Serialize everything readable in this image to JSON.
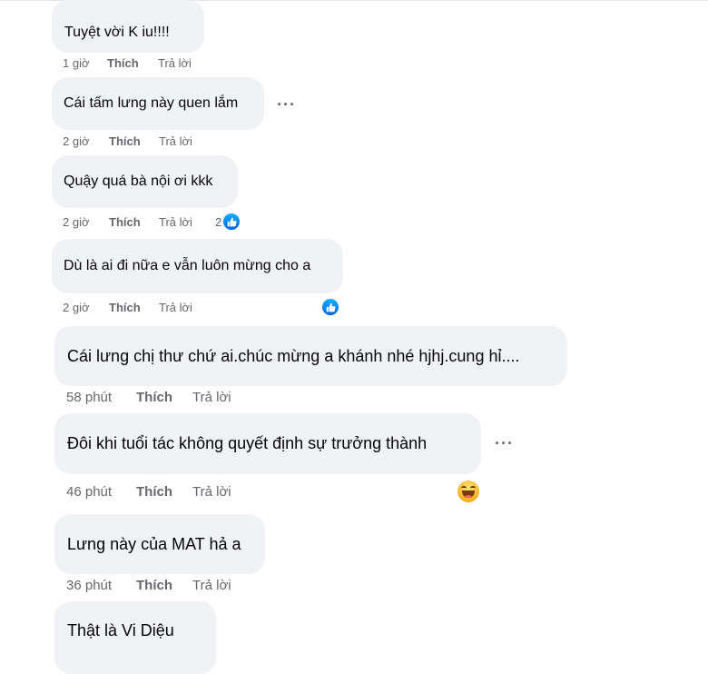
{
  "comments": [
    {
      "text": "Tuyệt vời K iu!!!!",
      "time": "1 giờ",
      "like": "Thích",
      "reply": "Trả lời"
    },
    {
      "text": "Cái tấm lưng này quen lắm",
      "time": "2 giờ",
      "like": "Thích",
      "reply": "Trả lời",
      "more": "···"
    },
    {
      "text": "Quậy quá bà nội ơi kkk",
      "time": "2 giờ",
      "like": "Thích",
      "reply": "Trả lời",
      "reaction_count": "2",
      "reaction": "like-icon"
    },
    {
      "text": "Dù là ai đi nữa e vẫn luôn mừng cho a",
      "time": "2 giờ",
      "like": "Thích",
      "reply": "Trả lời",
      "reaction": "like-icon"
    },
    {
      "text": "Cái lưng chị thư chứ ai.chúc mừng a khánh nhé hjhj.cung hỉ....",
      "time": "58 phút",
      "like": "Thích",
      "reply": "Trả lời"
    },
    {
      "text": "Đôi khi tuổi tác không quyết định sự trưởng thành",
      "time": "46 phút",
      "like": "Thích",
      "reply": "Trả lời",
      "more": "···",
      "reaction": "haha-icon"
    },
    {
      "text": "Lưng này của MAT hả a",
      "time": "36 phút",
      "like": "Thích",
      "reply": "Trả lời"
    },
    {
      "text": "Thật là Vi Diệu"
    }
  ],
  "colors": {
    "bubble": "#f0f2f5",
    "meta_text": "#65676b",
    "like_blue": "#0866ff",
    "haha_yellow": "#f7b125"
  }
}
